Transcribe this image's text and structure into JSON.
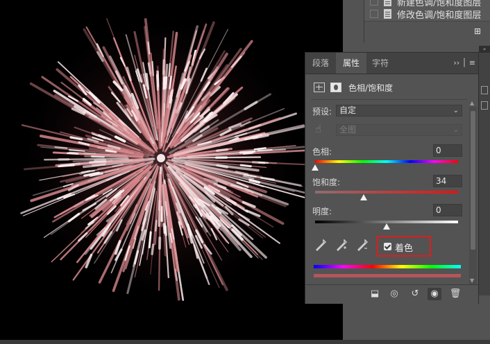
{
  "layers": {
    "rows": [
      {
        "name": "新建色调/饱和度图层"
      },
      {
        "name": "修改色调/饱和度图层"
      }
    ]
  },
  "properties": {
    "tabs": [
      "段落",
      "属性",
      "字符"
    ],
    "active_tab": "属性",
    "title": "色相/饱和度",
    "preset_label": "预设:",
    "preset_value": "自定",
    "channel_value": "全图",
    "hue_label": "色相:",
    "hue_value": "0",
    "saturation_label": "饱和度:",
    "saturation_value": "34",
    "lightness_label": "明度:",
    "lightness_value": "0",
    "colorize_label": "着色",
    "colorize_checked": true,
    "hue_slider_fraction": 0.0,
    "saturation_slider_fraction": 0.34,
    "lightness_slider_fraction": 0.5
  },
  "colors": {
    "highlight_box": "#e11c1c",
    "firework_tint": "#d9898e"
  }
}
